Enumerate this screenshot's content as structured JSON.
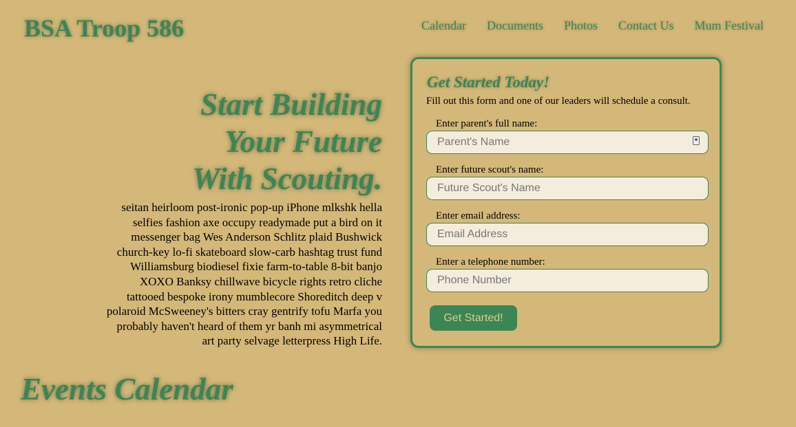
{
  "header": {
    "site_title": "BSA Troop 586",
    "nav": [
      "Calendar",
      "Documents",
      "Photos",
      "Contact Us",
      "Mum Festival"
    ]
  },
  "hero": {
    "heading_line1": "Start Building",
    "heading_line2": "Your Future",
    "heading_line3": "With Scouting.",
    "body": "seitan heirloom post-ironic pop-up iPhone mlkshk hella selfies fashion axe occupy readymade put a bird on it messenger bag Wes Anderson Schlitz plaid Bushwick church-key lo-fi skateboard slow-carb hashtag trust fund Williamsburg biodiesel fixie farm-to-table 8-bit banjo XOXO Banksy chillwave bicycle rights retro cliche tattooed bespoke irony mumblecore Shoreditch deep v polaroid McSweeney's bitters cray gentrify tofu Marfa you probably haven't heard of them yr banh mi asymmetrical art party selvage letterpress High Life."
  },
  "form": {
    "title": "Get Started Today!",
    "intro": "Fill out this form and one of our leaders will schedule a consult.",
    "fields": [
      {
        "label": "Enter parent's full name:",
        "placeholder": "Parent's Name",
        "value": ""
      },
      {
        "label": "Enter future scout's name:",
        "placeholder": "Future Scout's Name",
        "value": ""
      },
      {
        "label": "Enter email address:",
        "placeholder": "Email Address",
        "value": ""
      },
      {
        "label": "Enter a telephone number:",
        "placeholder": "Phone Number",
        "value": ""
      }
    ],
    "submit_label": "Get Started!"
  },
  "events": {
    "title": "Events Calendar"
  },
  "colors": {
    "background": "#d4b879",
    "accent_green": "#3b8654",
    "input_background": "#f4ecdd",
    "button_text": "#e0c98e"
  },
  "icons": {
    "parent_field_autofill": "contact-card-icon"
  }
}
